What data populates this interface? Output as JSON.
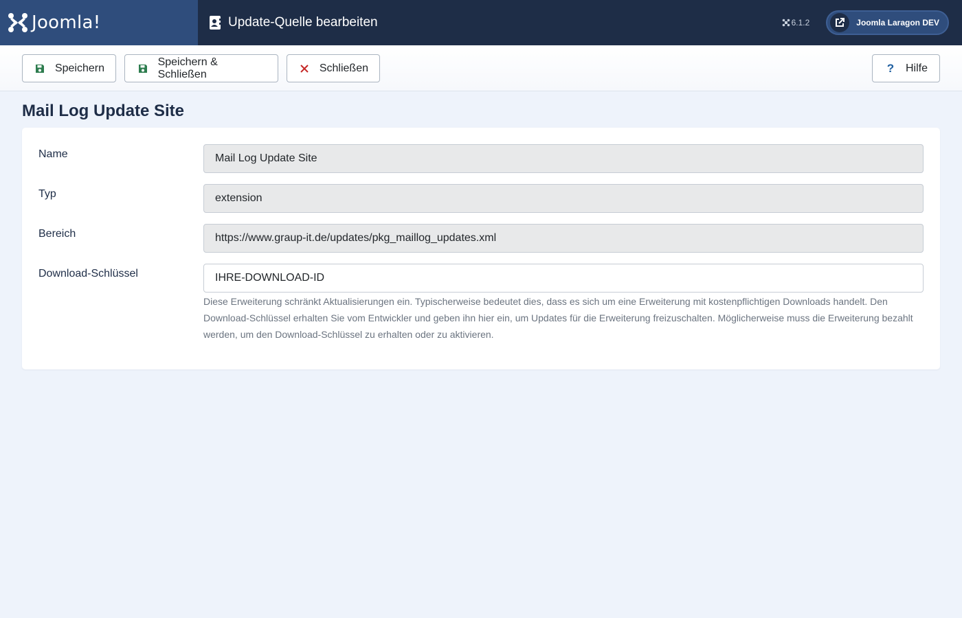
{
  "header": {
    "brand": "Joomla!",
    "title": "Update-Quelle bearbeiten",
    "version": "6.1.2",
    "site_link": "Joomla Laragon DEV"
  },
  "toolbar": {
    "save": "Speichern",
    "save_close": "Speichern & Schließen",
    "close": "Schließen",
    "help": "Hilfe"
  },
  "page": {
    "heading": "Mail Log Update Site"
  },
  "form": {
    "name_label": "Name",
    "name_value": "Mail Log Update Site",
    "type_label": "Typ",
    "type_value": "extension",
    "location_label": "Bereich",
    "location_value": "https://www.graup-it.de/updates/pkg_maillog_updates.xml",
    "key_label": "Download-Schlüssel",
    "key_value": "IHRE-DOWNLOAD-ID",
    "key_description": "Diese Erweiterung schränkt Aktualisierungen ein. Typischerweise bedeutet dies, dass es sich um eine Erweiterung mit kostenpflichtigen Downloads handelt. Den Download-Schlüssel erhalten Sie vom Entwickler und geben ihn hier ein, um Updates für die Erweiterung freizuschalten. Möglicherweise muss die Erweiterung bezahlt werden, um den Download-Schlüssel zu erhalten oder zu aktivieren."
  },
  "colors": {
    "header_bg": "#1e2d47",
    "brand_bg": "#2f4d7c",
    "save_icon": "#2e7d4f",
    "close_icon": "#c52827",
    "page_bg": "#eef3fb"
  },
  "icons": {
    "brand": "joomla-logo-icon",
    "title": "address-card-icon",
    "version": "joomla-small-icon",
    "site_link": "external-link-icon",
    "save": "floppy-disk-icon",
    "close": "x-icon",
    "help": "question-icon"
  }
}
